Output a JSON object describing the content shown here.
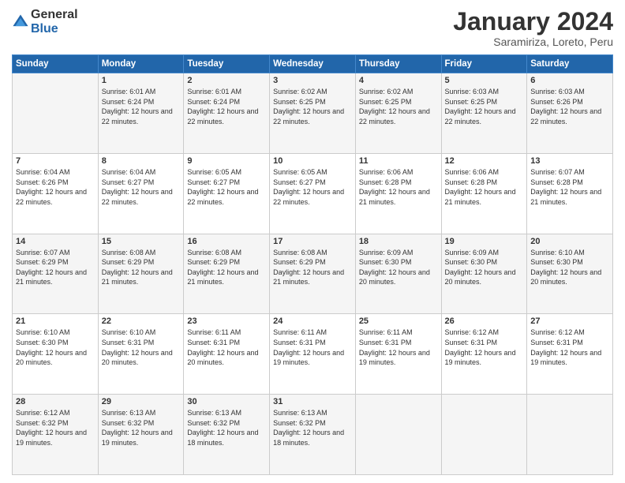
{
  "logo": {
    "general": "General",
    "blue": "Blue"
  },
  "header": {
    "month": "January 2024",
    "location": "Saramiriza, Loreto, Peru"
  },
  "weekdays": [
    "Sunday",
    "Monday",
    "Tuesday",
    "Wednesday",
    "Thursday",
    "Friday",
    "Saturday"
  ],
  "weeks": [
    [
      {
        "day": "",
        "sunrise": "",
        "sunset": "",
        "daylight": ""
      },
      {
        "day": "1",
        "sunrise": "Sunrise: 6:01 AM",
        "sunset": "Sunset: 6:24 PM",
        "daylight": "Daylight: 12 hours and 22 minutes."
      },
      {
        "day": "2",
        "sunrise": "Sunrise: 6:01 AM",
        "sunset": "Sunset: 6:24 PM",
        "daylight": "Daylight: 12 hours and 22 minutes."
      },
      {
        "day": "3",
        "sunrise": "Sunrise: 6:02 AM",
        "sunset": "Sunset: 6:25 PM",
        "daylight": "Daylight: 12 hours and 22 minutes."
      },
      {
        "day": "4",
        "sunrise": "Sunrise: 6:02 AM",
        "sunset": "Sunset: 6:25 PM",
        "daylight": "Daylight: 12 hours and 22 minutes."
      },
      {
        "day": "5",
        "sunrise": "Sunrise: 6:03 AM",
        "sunset": "Sunset: 6:25 PM",
        "daylight": "Daylight: 12 hours and 22 minutes."
      },
      {
        "day": "6",
        "sunrise": "Sunrise: 6:03 AM",
        "sunset": "Sunset: 6:26 PM",
        "daylight": "Daylight: 12 hours and 22 minutes."
      }
    ],
    [
      {
        "day": "7",
        "sunrise": "Sunrise: 6:04 AM",
        "sunset": "Sunset: 6:26 PM",
        "daylight": "Daylight: 12 hours and 22 minutes."
      },
      {
        "day": "8",
        "sunrise": "Sunrise: 6:04 AM",
        "sunset": "Sunset: 6:27 PM",
        "daylight": "Daylight: 12 hours and 22 minutes."
      },
      {
        "day": "9",
        "sunrise": "Sunrise: 6:05 AM",
        "sunset": "Sunset: 6:27 PM",
        "daylight": "Daylight: 12 hours and 22 minutes."
      },
      {
        "day": "10",
        "sunrise": "Sunrise: 6:05 AM",
        "sunset": "Sunset: 6:27 PM",
        "daylight": "Daylight: 12 hours and 22 minutes."
      },
      {
        "day": "11",
        "sunrise": "Sunrise: 6:06 AM",
        "sunset": "Sunset: 6:28 PM",
        "daylight": "Daylight: 12 hours and 21 minutes."
      },
      {
        "day": "12",
        "sunrise": "Sunrise: 6:06 AM",
        "sunset": "Sunset: 6:28 PM",
        "daylight": "Daylight: 12 hours and 21 minutes."
      },
      {
        "day": "13",
        "sunrise": "Sunrise: 6:07 AM",
        "sunset": "Sunset: 6:28 PM",
        "daylight": "Daylight: 12 hours and 21 minutes."
      }
    ],
    [
      {
        "day": "14",
        "sunrise": "Sunrise: 6:07 AM",
        "sunset": "Sunset: 6:29 PM",
        "daylight": "Daylight: 12 hours and 21 minutes."
      },
      {
        "day": "15",
        "sunrise": "Sunrise: 6:08 AM",
        "sunset": "Sunset: 6:29 PM",
        "daylight": "Daylight: 12 hours and 21 minutes."
      },
      {
        "day": "16",
        "sunrise": "Sunrise: 6:08 AM",
        "sunset": "Sunset: 6:29 PM",
        "daylight": "Daylight: 12 hours and 21 minutes."
      },
      {
        "day": "17",
        "sunrise": "Sunrise: 6:08 AM",
        "sunset": "Sunset: 6:29 PM",
        "daylight": "Daylight: 12 hours and 21 minutes."
      },
      {
        "day": "18",
        "sunrise": "Sunrise: 6:09 AM",
        "sunset": "Sunset: 6:30 PM",
        "daylight": "Daylight: 12 hours and 20 minutes."
      },
      {
        "day": "19",
        "sunrise": "Sunrise: 6:09 AM",
        "sunset": "Sunset: 6:30 PM",
        "daylight": "Daylight: 12 hours and 20 minutes."
      },
      {
        "day": "20",
        "sunrise": "Sunrise: 6:10 AM",
        "sunset": "Sunset: 6:30 PM",
        "daylight": "Daylight: 12 hours and 20 minutes."
      }
    ],
    [
      {
        "day": "21",
        "sunrise": "Sunrise: 6:10 AM",
        "sunset": "Sunset: 6:30 PM",
        "daylight": "Daylight: 12 hours and 20 minutes."
      },
      {
        "day": "22",
        "sunrise": "Sunrise: 6:10 AM",
        "sunset": "Sunset: 6:31 PM",
        "daylight": "Daylight: 12 hours and 20 minutes."
      },
      {
        "day": "23",
        "sunrise": "Sunrise: 6:11 AM",
        "sunset": "Sunset: 6:31 PM",
        "daylight": "Daylight: 12 hours and 20 minutes."
      },
      {
        "day": "24",
        "sunrise": "Sunrise: 6:11 AM",
        "sunset": "Sunset: 6:31 PM",
        "daylight": "Daylight: 12 hours and 19 minutes."
      },
      {
        "day": "25",
        "sunrise": "Sunrise: 6:11 AM",
        "sunset": "Sunset: 6:31 PM",
        "daylight": "Daylight: 12 hours and 19 minutes."
      },
      {
        "day": "26",
        "sunrise": "Sunrise: 6:12 AM",
        "sunset": "Sunset: 6:31 PM",
        "daylight": "Daylight: 12 hours and 19 minutes."
      },
      {
        "day": "27",
        "sunrise": "Sunrise: 6:12 AM",
        "sunset": "Sunset: 6:31 PM",
        "daylight": "Daylight: 12 hours and 19 minutes."
      }
    ],
    [
      {
        "day": "28",
        "sunrise": "Sunrise: 6:12 AM",
        "sunset": "Sunset: 6:32 PM",
        "daylight": "Daylight: 12 hours and 19 minutes."
      },
      {
        "day": "29",
        "sunrise": "Sunrise: 6:13 AM",
        "sunset": "Sunset: 6:32 PM",
        "daylight": "Daylight: 12 hours and 19 minutes."
      },
      {
        "day": "30",
        "sunrise": "Sunrise: 6:13 AM",
        "sunset": "Sunset: 6:32 PM",
        "daylight": "Daylight: 12 hours and 18 minutes."
      },
      {
        "day": "31",
        "sunrise": "Sunrise: 6:13 AM",
        "sunset": "Sunset: 6:32 PM",
        "daylight": "Daylight: 12 hours and 18 minutes."
      },
      {
        "day": "",
        "sunrise": "",
        "sunset": "",
        "daylight": ""
      },
      {
        "day": "",
        "sunrise": "",
        "sunset": "",
        "daylight": ""
      },
      {
        "day": "",
        "sunrise": "",
        "sunset": "",
        "daylight": ""
      }
    ]
  ]
}
